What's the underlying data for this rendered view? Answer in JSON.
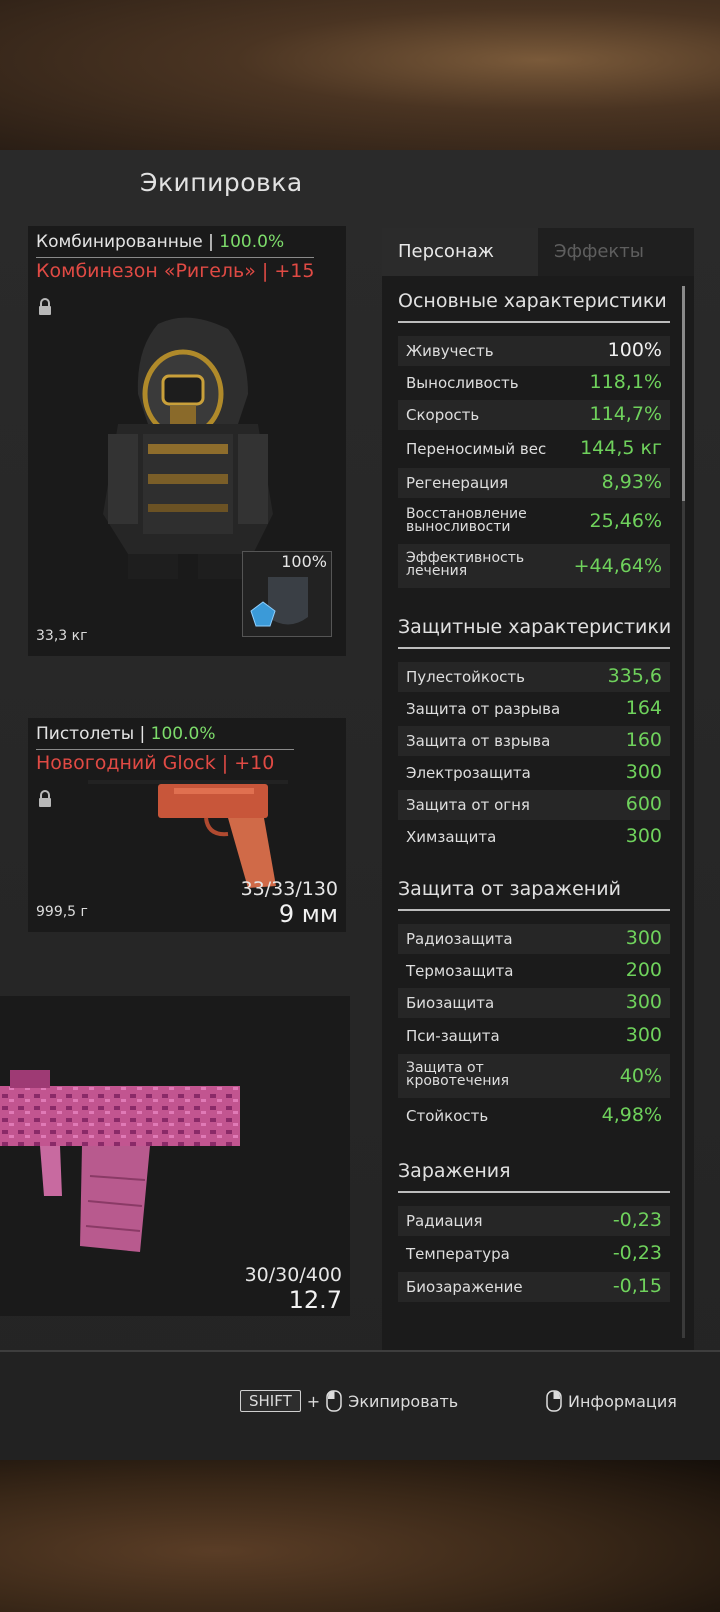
{
  "header": {
    "title": "Экипировка"
  },
  "armor": {
    "category": "Комбинированные |",
    "percent": "100.0%",
    "name": "Комбинезон «Ригель» | +15",
    "weight": "33,3 кг",
    "plate_percent": "100%"
  },
  "pistol": {
    "category": "Пистолеты |",
    "percent": "100.0%",
    "name": "Новогодний Glock | +10",
    "weight": "999,5 г",
    "ammo": "33/33/130",
    "caliber": "9 мм"
  },
  "rifle": {
    "ammo": "30/30/400",
    "caliber": "12.7"
  },
  "stats": {
    "tabs": [
      "Персонаж",
      "Эффекты"
    ],
    "sections": {
      "main": {
        "title": "Основные характеристики",
        "rows": [
          {
            "label": "Живучесть",
            "value": "100%"
          },
          {
            "label": "Выносливость",
            "value": "118,1%"
          },
          {
            "label": "Скорость",
            "value": "114,7%"
          },
          {
            "label": "Переносимый вес",
            "value": "144,5 кг"
          },
          {
            "label": "Регенерация",
            "value": "8,93%"
          },
          {
            "label": "Восстановление выносливости",
            "value": "25,46%"
          },
          {
            "label": "Эффективность лечения",
            "value": "+44,64%"
          }
        ]
      },
      "defense": {
        "title": "Защитные характеристики",
        "rows": [
          {
            "label": "Пулестойкость",
            "value": "335,6"
          },
          {
            "label": "Защита от разрыва",
            "value": "164"
          },
          {
            "label": "Защита от взрыва",
            "value": "160"
          },
          {
            "label": "Электрозащита",
            "value": "300"
          },
          {
            "label": "Защита от огня",
            "value": "600"
          },
          {
            "label": "Химзащита",
            "value": "300"
          }
        ]
      },
      "infection_protection": {
        "title": "Защита от заражений",
        "rows": [
          {
            "label": "Радиозащита",
            "value": "300"
          },
          {
            "label": "Термозащита",
            "value": "200"
          },
          {
            "label": "Биозащита",
            "value": "300"
          },
          {
            "label": "Пси-защита",
            "value": "300"
          },
          {
            "label": "Защита от кровотечения",
            "value": "40%"
          },
          {
            "label": "Стойкость",
            "value": "4,98%"
          }
        ]
      },
      "infections": {
        "title": "Заражения",
        "rows": [
          {
            "label": "Радиация",
            "value": "-0,23"
          },
          {
            "label": "Температура",
            "value": "-0,23"
          },
          {
            "label": "Биозаражение",
            "value": "-0,15"
          }
        ]
      }
    }
  },
  "footer": {
    "shift_key": "SHIFT",
    "plus": "+",
    "equip_label": "Экипировать",
    "info_label": "Информация"
  },
  "colors": {
    "positive": "#6fd25c",
    "item_name": "#e04a44",
    "bg": "#242424"
  }
}
